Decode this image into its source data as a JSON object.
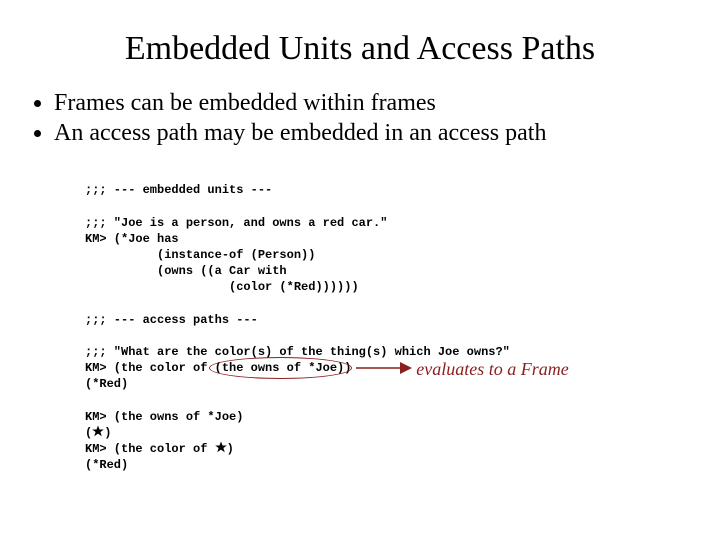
{
  "title": "Embedded Units and Access Paths",
  "bullets": [
    "Frames can be embedded within frames",
    "An access path may be embedded in an access path"
  ],
  "code": {
    "l01": ";;; --- embedded units ---",
    "l02": "",
    "l03": ";;; \"Joe is a person, and owns a red car.\"",
    "l04": "KM> (*Joe has",
    "l05": "          (instance-of (Person))",
    "l06": "          (owns ((a Car with",
    "l07": "                    (color (*Red))))))",
    "l08": "",
    "l09": ";;; --- access paths ---",
    "l10": "",
    "l11": ";;; \"What are the color(s) of the thing(s) which Joe owns?\"",
    "l12a": "KM> (the color of ",
    "l12b": "(the owns of *Joe)",
    "l12c": ")",
    "l13": "(*Red)",
    "l14": "",
    "l15": "KM> (the owns of *Joe)",
    "l16a": "(",
    "l16b": ")",
    "l17a": "KM> (the color of ",
    "l17b": ")",
    "l18": "(*Red)"
  },
  "annotation": "evaluates to a Frame"
}
